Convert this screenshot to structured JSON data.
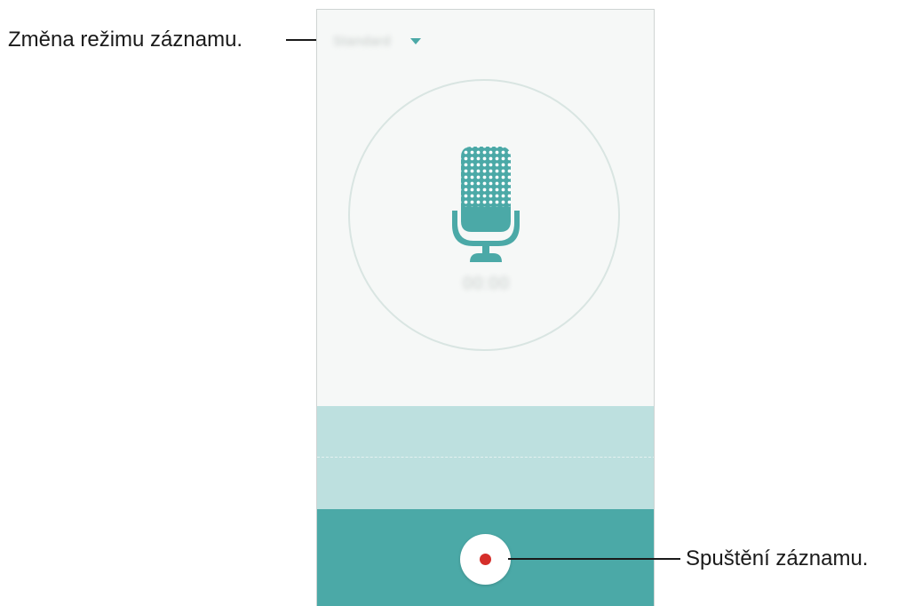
{
  "callouts": {
    "mode": "Změna režimu záznamu.",
    "record": "Spuštění záznamu."
  },
  "screen": {
    "mode_label": "Standard",
    "timer": "00:00"
  },
  "icons": {
    "dropdown": "chevron-down-icon",
    "microphone": "microphone-icon",
    "record": "record-icon"
  },
  "colors": {
    "accent": "#4ba9a7",
    "waveform_bg": "#bde0df",
    "record_dot": "#d52e2a",
    "screen_bg": "#f6f8f7"
  }
}
